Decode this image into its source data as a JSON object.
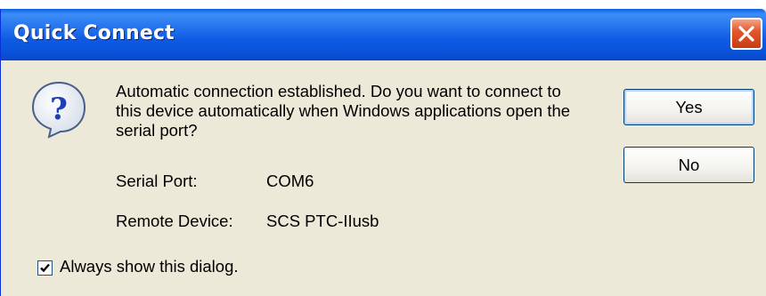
{
  "dialog": {
    "title": "Quick Connect",
    "message": "Automatic connection established.  Do you want to connect to this device automatically when Windows applications open the serial port?",
    "serial_port_label": "Serial Port:",
    "serial_port_value": "COM6",
    "remote_device_label": "Remote Device:",
    "remote_device_value": "SCS PTC-IIusb",
    "yes_label": "Yes",
    "no_label": "No",
    "checkbox_label": "Always show this dialog.",
    "checkbox_checked": true
  },
  "icons": {
    "close": "close-icon",
    "question": "question-icon",
    "check": "checkmark-icon"
  },
  "colors": {
    "titlebar": "#0A52D8",
    "close_button": "#E2582E",
    "dialog_background": "#ECE9D8",
    "button_border": "#003C74"
  }
}
